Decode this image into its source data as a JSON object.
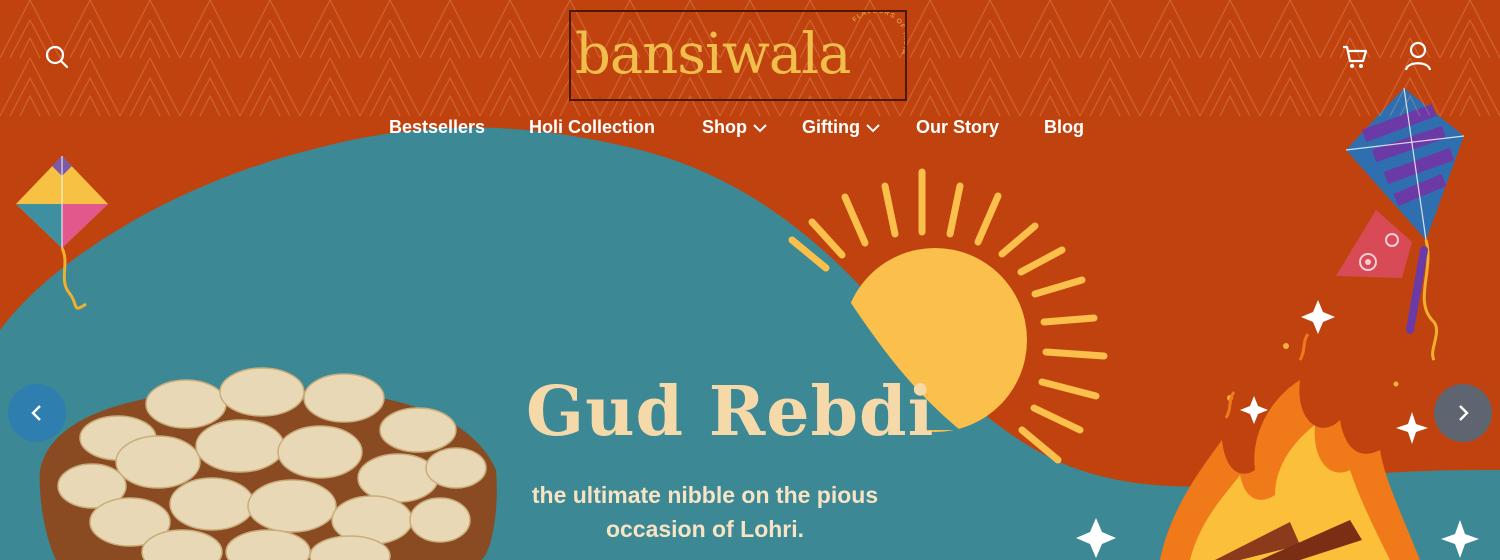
{
  "header": {
    "logo_text": "bansiwala",
    "logo_tagline": "FLAVOURS OF INDIA",
    "search_icon": "search-icon",
    "cart_icon": "cart-icon",
    "account_icon": "user-icon"
  },
  "nav": {
    "items": [
      {
        "label": "Bestsellers"
      },
      {
        "label": "Holi Collection"
      },
      {
        "label": "Shop",
        "has_dropdown": true
      },
      {
        "label": "Gifting",
        "has_dropdown": true
      },
      {
        "label": "Our Story"
      },
      {
        "label": "Blog"
      }
    ]
  },
  "hero": {
    "title": "Gud Rebdi",
    "subtitle": "the ultimate nibble on the pious occasion of Lohri.",
    "prev_icon": "chevron-left-icon",
    "next_icon": "chevron-right-icon"
  },
  "colors": {
    "background": "#c0430f",
    "teal": "#3c8895",
    "sun": "#fbbf4c",
    "title": "#f6d9a8",
    "logo_gold": "#f0be4b"
  }
}
